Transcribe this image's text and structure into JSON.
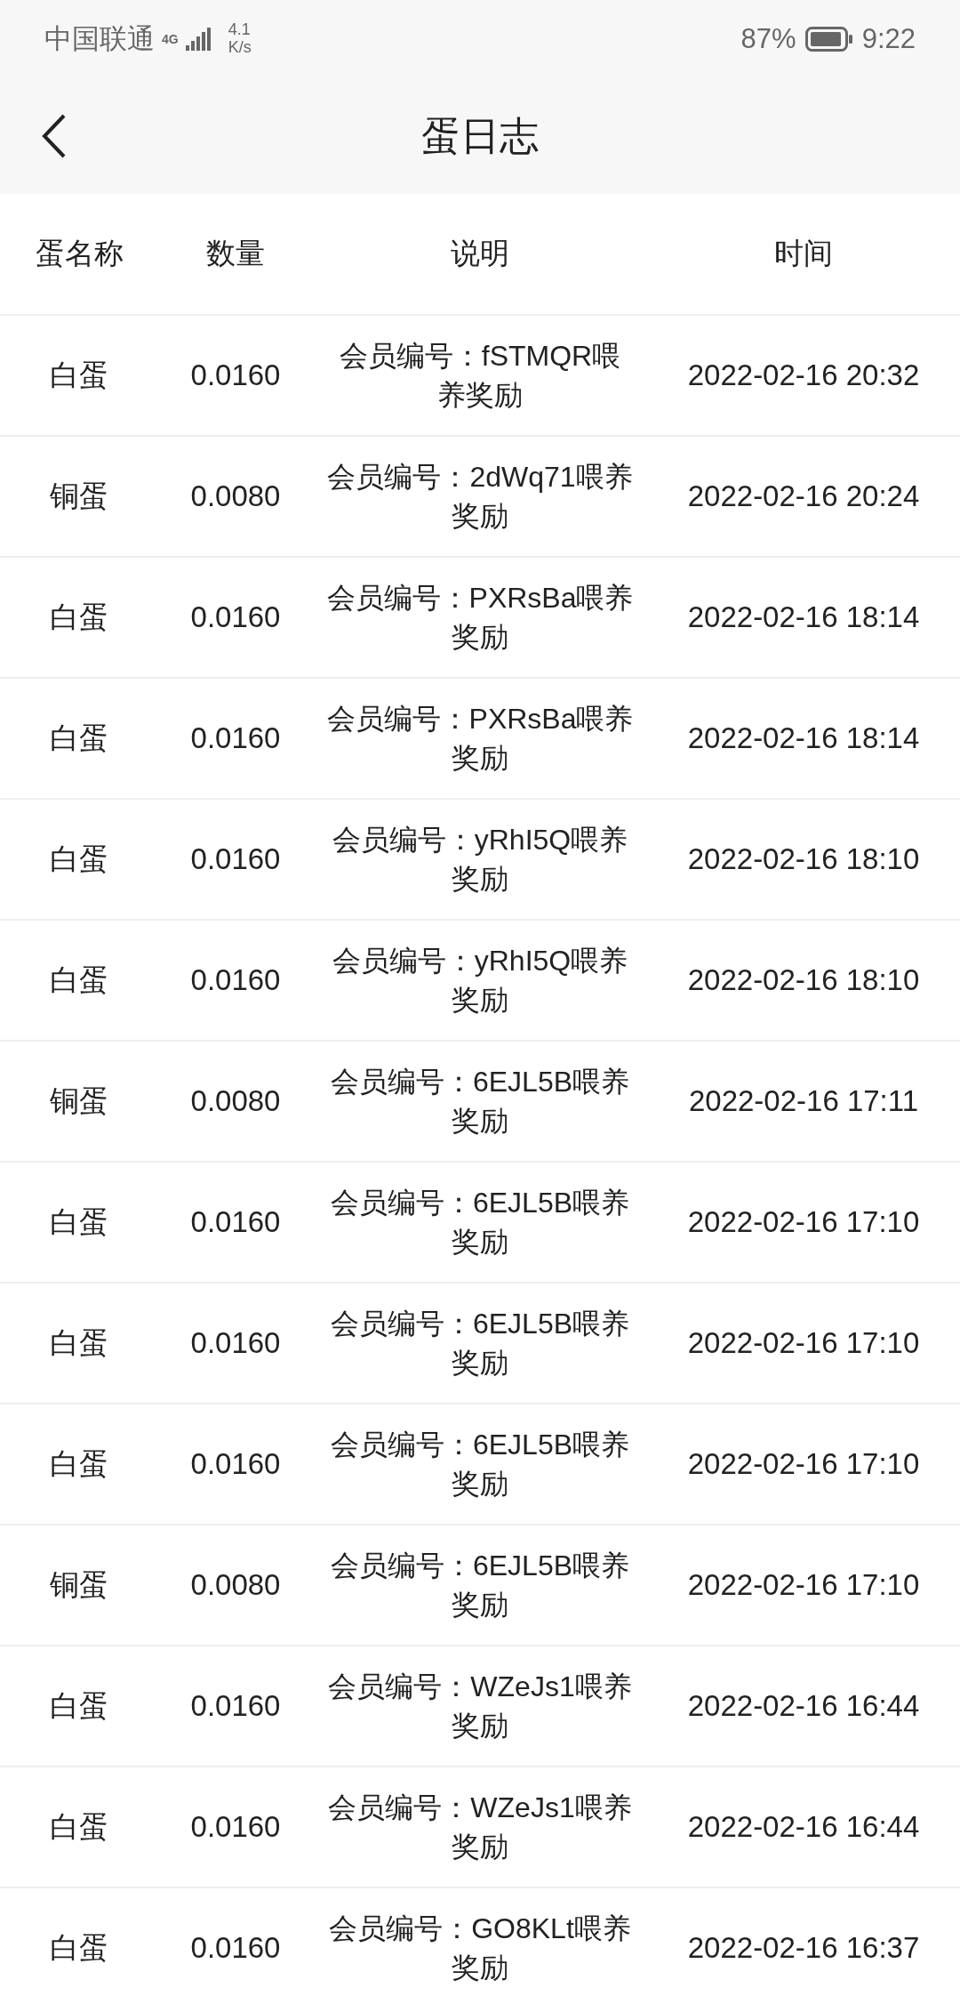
{
  "status_bar": {
    "carrier": "中国联通",
    "network": "4G",
    "speed_value": "4.1",
    "speed_unit": "K/s",
    "battery_percent": "87%",
    "time": "9:22"
  },
  "header": {
    "title": "蛋日志"
  },
  "table": {
    "columns": [
      "蛋名称",
      "数量",
      "说明",
      "时间"
    ],
    "rows": [
      {
        "name": "白蛋",
        "amount": "0.0160",
        "note": "会员编号：fSTMQR喂养奖励",
        "time": "2022-02-16 20:32"
      },
      {
        "name": "铜蛋",
        "amount": "0.0080",
        "note": "会员编号：2dWq71喂养奖励",
        "time": "2022-02-16 20:24"
      },
      {
        "name": "白蛋",
        "amount": "0.0160",
        "note": "会员编号：PXRsBa喂养奖励",
        "time": "2022-02-16 18:14"
      },
      {
        "name": "白蛋",
        "amount": "0.0160",
        "note": "会员编号：PXRsBa喂养奖励",
        "time": "2022-02-16 18:14"
      },
      {
        "name": "白蛋",
        "amount": "0.0160",
        "note": "会员编号：yRhI5Q喂养奖励",
        "time": "2022-02-16 18:10"
      },
      {
        "name": "白蛋",
        "amount": "0.0160",
        "note": "会员编号：yRhI5Q喂养奖励",
        "time": "2022-02-16 18:10"
      },
      {
        "name": "铜蛋",
        "amount": "0.0080",
        "note": "会员编号：6EJL5B喂养奖励",
        "time": "2022-02-16 17:11"
      },
      {
        "name": "白蛋",
        "amount": "0.0160",
        "note": "会员编号：6EJL5B喂养奖励",
        "time": "2022-02-16 17:10"
      },
      {
        "name": "白蛋",
        "amount": "0.0160",
        "note": "会员编号：6EJL5B喂养奖励",
        "time": "2022-02-16 17:10"
      },
      {
        "name": "白蛋",
        "amount": "0.0160",
        "note": "会员编号：6EJL5B喂养奖励",
        "time": "2022-02-16 17:10"
      },
      {
        "name": "铜蛋",
        "amount": "0.0080",
        "note": "会员编号：6EJL5B喂养奖励",
        "time": "2022-02-16 17:10"
      },
      {
        "name": "白蛋",
        "amount": "0.0160",
        "note": "会员编号：WZeJs1喂养奖励",
        "time": "2022-02-16 16:44"
      },
      {
        "name": "白蛋",
        "amount": "0.0160",
        "note": "会员编号：WZeJs1喂养奖励",
        "time": "2022-02-16 16:44"
      },
      {
        "name": "白蛋",
        "amount": "0.0160",
        "note": "会员编号：GO8KLt喂养奖励",
        "time": "2022-02-16 16:37"
      }
    ]
  }
}
